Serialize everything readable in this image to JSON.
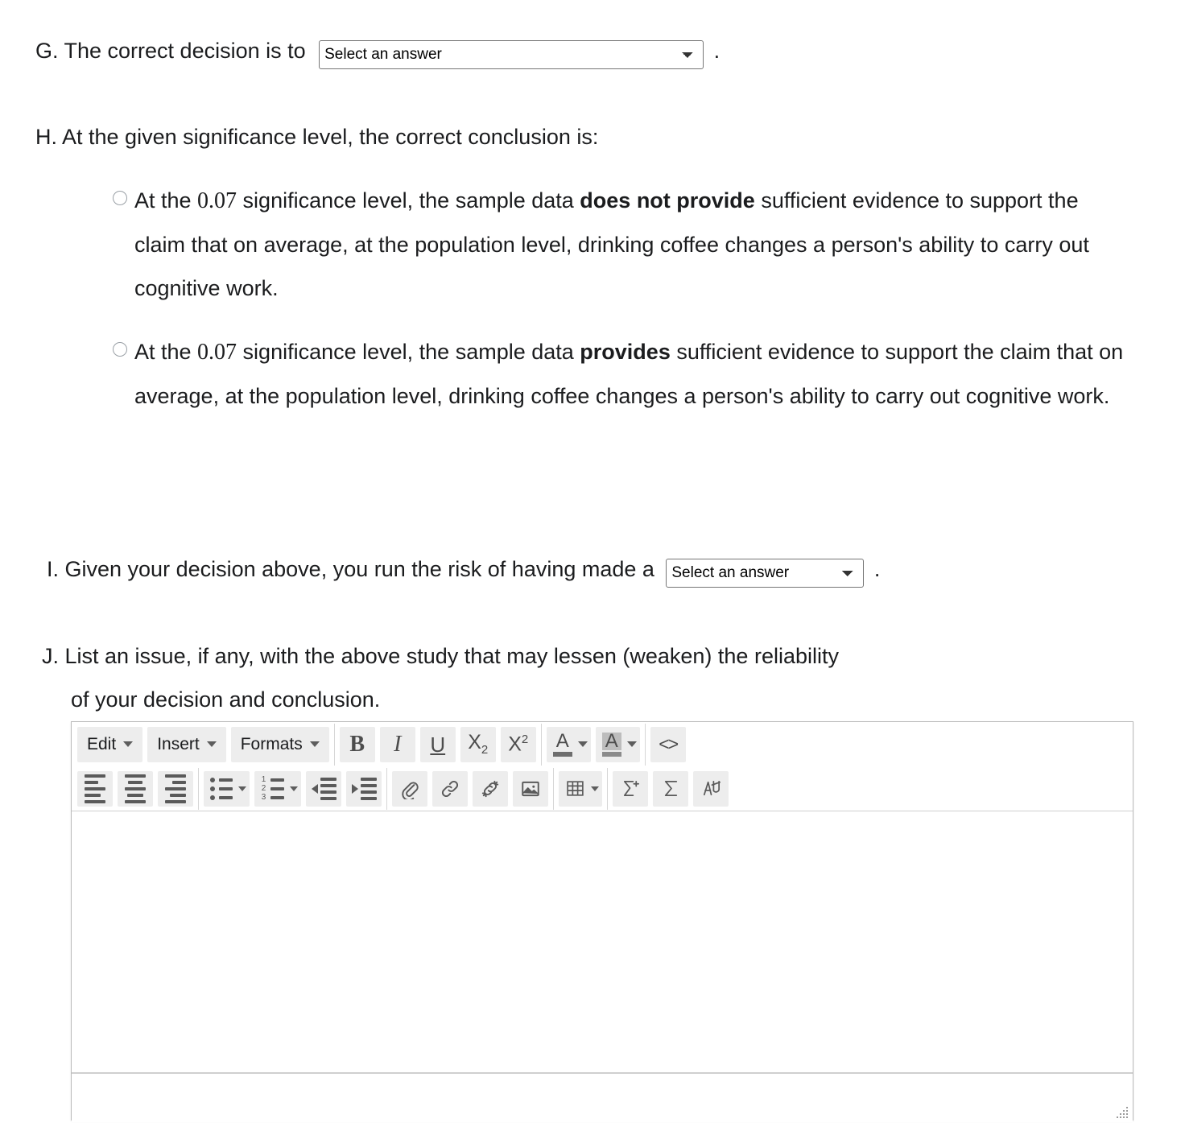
{
  "questions": {
    "g": {
      "prefix": "G. The correct decision is to",
      "select_value": "Select an answer",
      "suffix": "."
    },
    "h": {
      "prompt": "H. At the given significance level, the correct conclusion is:",
      "options": [
        {
          "part1": "At the ",
          "math": "0.07",
          "part2": " significance level, the sample data ",
          "emphasis": "does not provide",
          "part3": " sufficient evidence to support the claim that on average, at the population level, drinking coffee changes a person's ability to carry out cognitive work."
        },
        {
          "part1": "At the ",
          "math": "0.07",
          "part2": " significance level, the sample data ",
          "emphasis": "provides",
          "part3": " sufficient evidence to support the claim that on average, at the population level, drinking coffee changes a person's ability to carry out cognitive work."
        }
      ]
    },
    "i": {
      "prefix": "I. Given your decision above, you run the risk of having made a",
      "select_value": "Select an answer",
      "suffix": "."
    },
    "j": {
      "prompt_line1": "J. List an issue, if any, with the above study that may lessen (weaken) the reliability",
      "prompt_line2": "of your decision and conclusion."
    }
  },
  "editor": {
    "menus": [
      {
        "label": "Edit",
        "name": "edit-menu"
      },
      {
        "label": "Insert",
        "name": "insert-menu"
      },
      {
        "label": "Formats",
        "name": "formats-menu"
      }
    ],
    "row1_buttons": [
      {
        "name": "bold-button",
        "glyph": "B"
      },
      {
        "name": "italic-button",
        "glyph": "I"
      },
      {
        "name": "underline-button",
        "glyph": "U"
      },
      {
        "name": "subscript-button",
        "glyph": "X₂"
      },
      {
        "name": "superscript-button",
        "glyph": "X²"
      },
      {
        "name": "text-color-button",
        "glyph": "A"
      },
      {
        "name": "background-color-button",
        "glyph": "A"
      },
      {
        "name": "source-code-button",
        "glyph": "<>"
      }
    ],
    "row2_buttons": [
      {
        "name": "align-left-button"
      },
      {
        "name": "align-center-button"
      },
      {
        "name": "align-right-button"
      },
      {
        "name": "bullet-list-button"
      },
      {
        "name": "numbered-list-button"
      },
      {
        "name": "outdent-button"
      },
      {
        "name": "indent-button"
      },
      {
        "name": "attachment-button"
      },
      {
        "name": "insert-link-button"
      },
      {
        "name": "remove-link-button"
      },
      {
        "name": "insert-image-button"
      },
      {
        "name": "table-button"
      },
      {
        "name": "insert-equation-button"
      },
      {
        "name": "math-button"
      },
      {
        "name": "handwriting-button"
      }
    ],
    "content": "",
    "colors": {
      "text_swatch": "#6e6e6e",
      "highlight_swatch": "#bdbdbd",
      "button_background": "#ededed",
      "icon_color": "#4d4d4d",
      "border": "#bbbbbb"
    }
  }
}
